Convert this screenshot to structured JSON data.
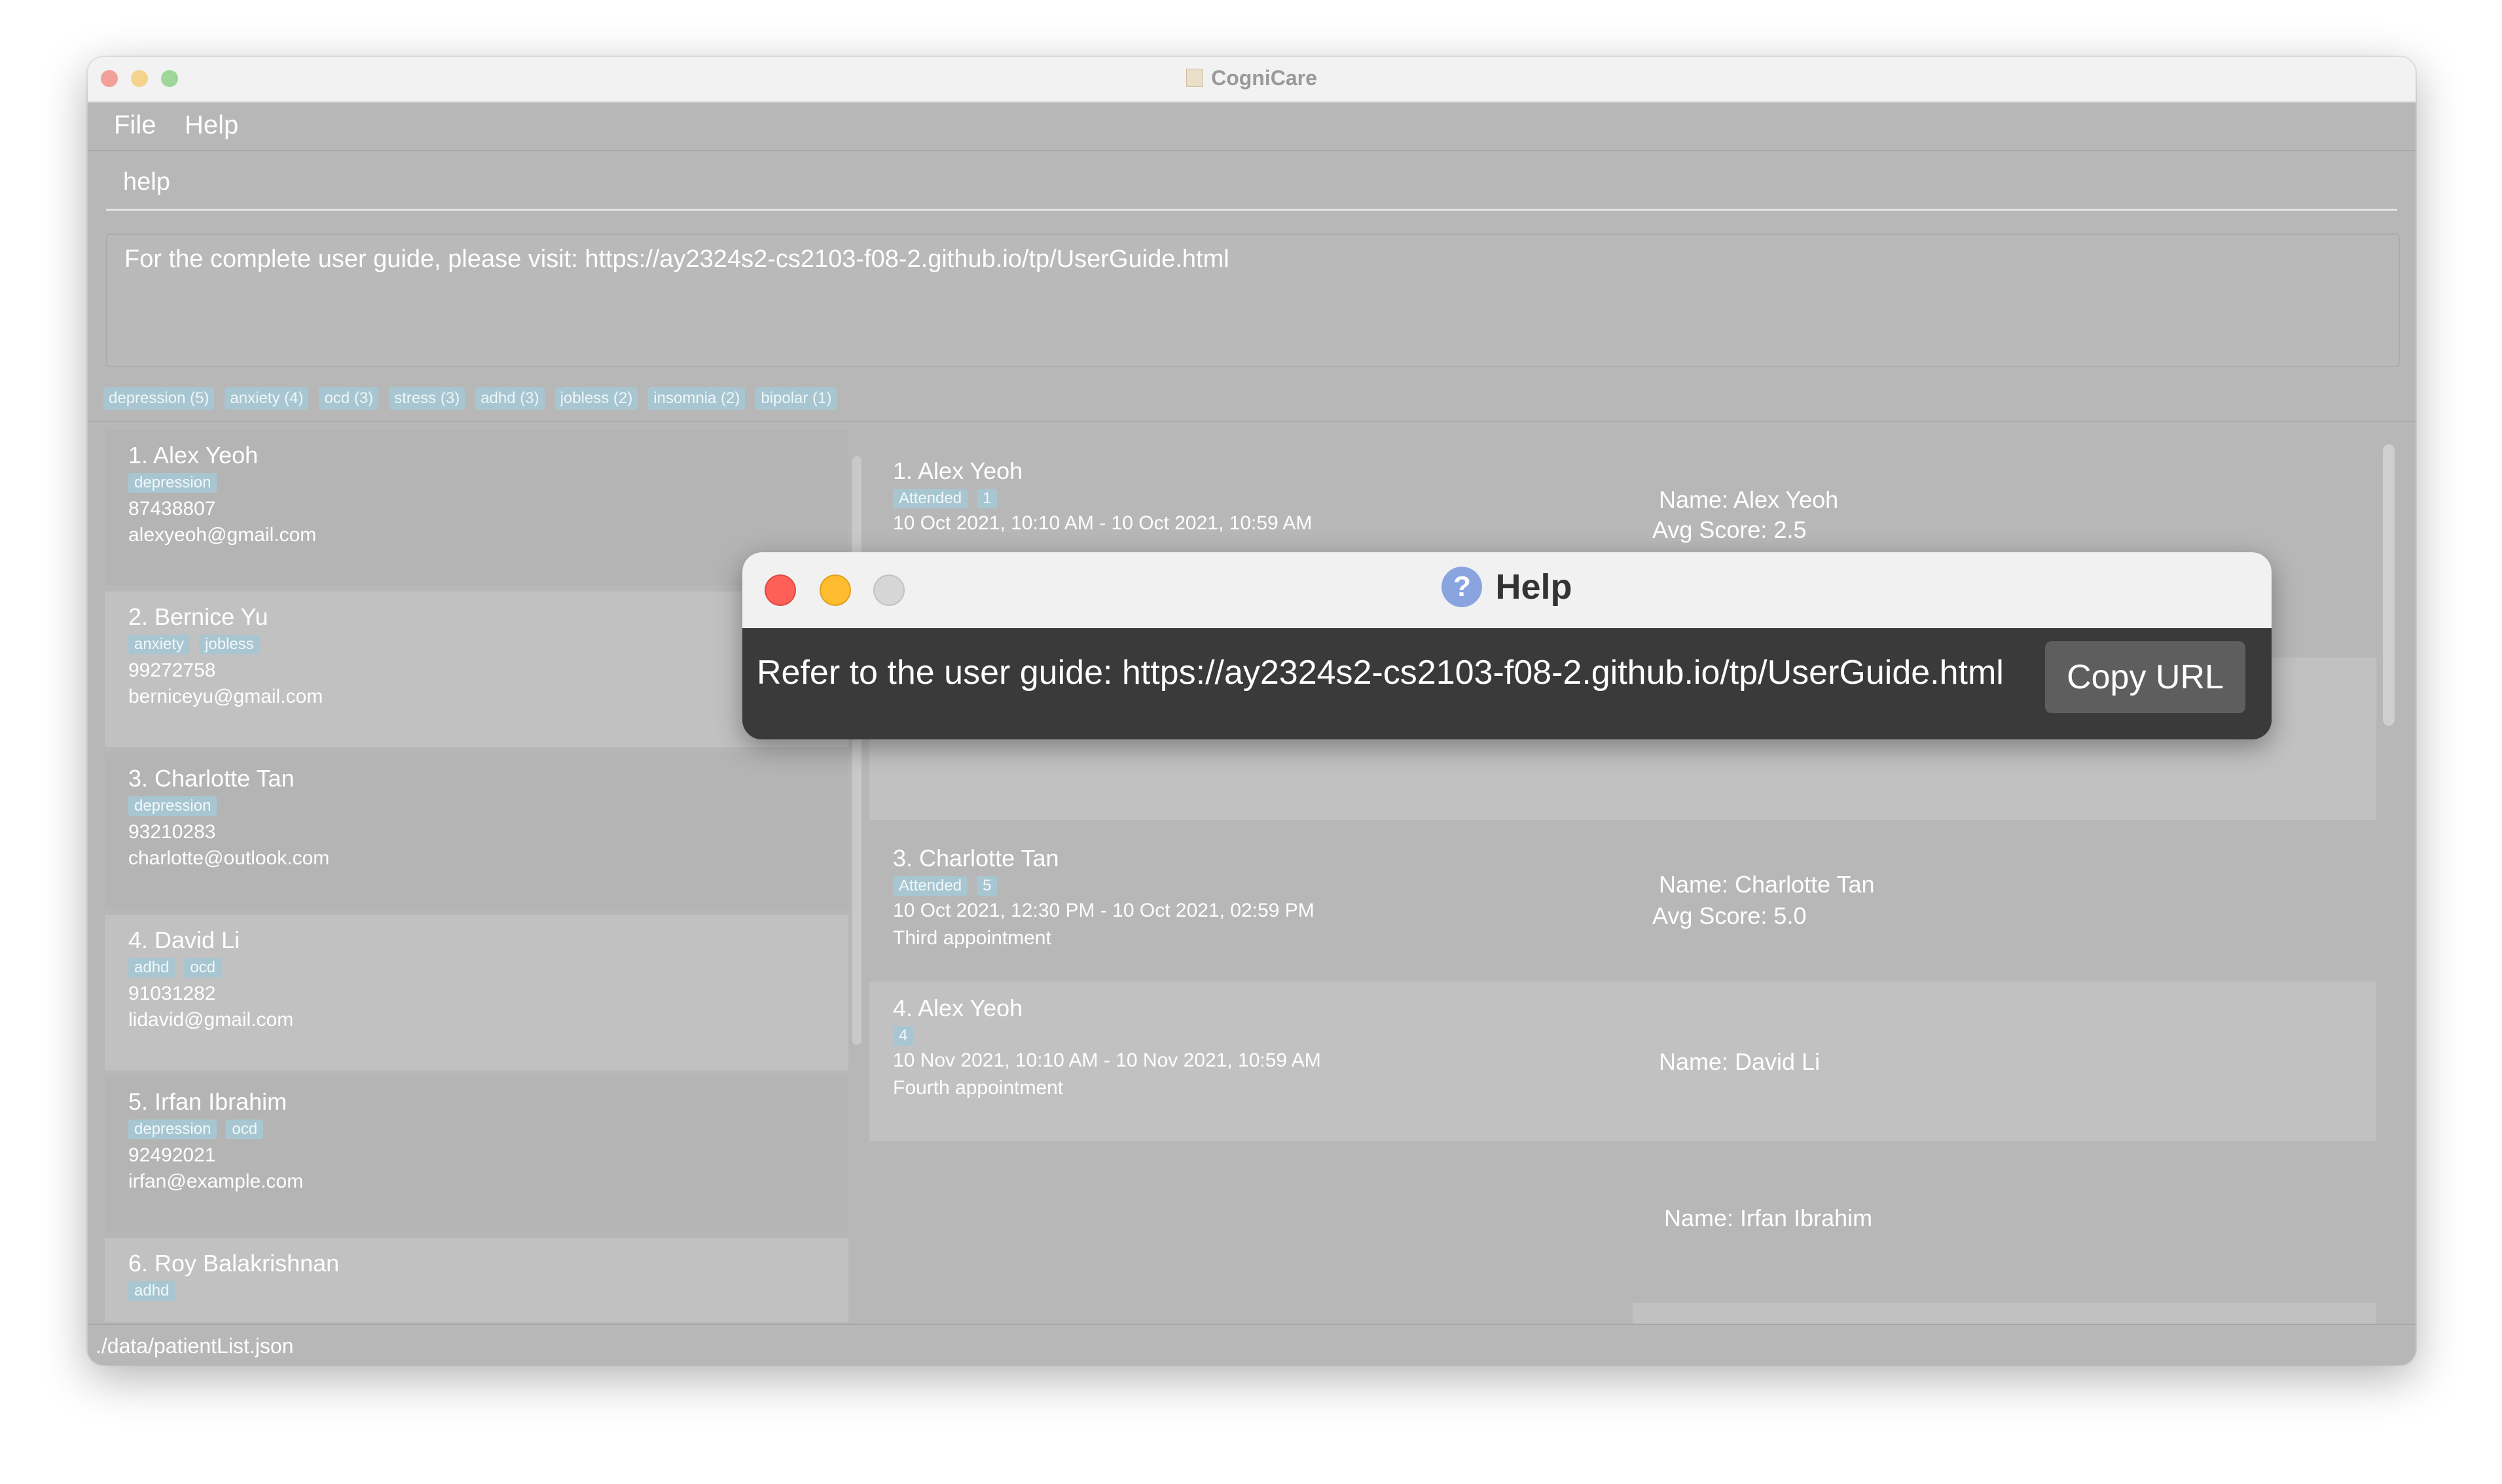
{
  "window": {
    "title": "CogniCare"
  },
  "menu": {
    "file": "File",
    "help": "Help"
  },
  "command": {
    "value": "help"
  },
  "result": {
    "text": "For the complete user guide, please visit: https://ay2324s2-cs2103-f08-2.github.io/tp/UserGuide.html"
  },
  "tags": [
    "depression (5)",
    "anxiety (4)",
    "ocd (3)",
    "stress (3)",
    "adhd (3)",
    "jobless (2)",
    "insomnia (2)",
    "bipolar (1)"
  ],
  "patients": [
    {
      "name": "1.  Alex Yeoh",
      "tags": [
        "depression"
      ],
      "phone": "87438807",
      "email": "alexyeoh@gmail.com"
    },
    {
      "name": "2.  Bernice Yu",
      "tags": [
        "anxiety",
        "jobless"
      ],
      "phone": "99272758",
      "email": "berniceyu@gmail.com"
    },
    {
      "name": "3.  Charlotte Tan",
      "tags": [
        "depression"
      ],
      "phone": "93210283",
      "email": "charlotte@outlook.com"
    },
    {
      "name": "4.  David Li",
      "tags": [
        "adhd",
        "ocd"
      ],
      "phone": "91031282",
      "email": "lidavid@gmail.com"
    },
    {
      "name": "5.  Irfan Ibrahim",
      "tags": [
        "depression",
        "ocd"
      ],
      "phone": "92492021",
      "email": "irfan@example.com"
    },
    {
      "name": "6.  Roy Balakrishnan",
      "tags": [
        "adhd"
      ]
    }
  ],
  "appointments": [
    {
      "title": "1.  Alex Yeoh",
      "tags": [
        "Attended",
        "1"
      ],
      "time": "10 Oct 2021, 10:10 AM - 10 Oct 2021, 10:59 AM",
      "description": "",
      "score_name": "Name: Alex Yeoh",
      "avg_score": "Avg Score: 2.5"
    },
    {
      "title": "3.  Charlotte Tan",
      "tags": [
        "Attended",
        "5"
      ],
      "time": "10 Oct 2021, 12:30 PM - 10 Oct 2021, 02:59 PM",
      "description": "Third appointment",
      "score_name": "Name: Charlotte Tan",
      "avg_score": "Avg Score: 5.0"
    },
    {
      "title": "4.  Alex Yeoh",
      "tags": [
        "4"
      ],
      "time": "10 Nov 2021, 10:10 AM - 10 Nov 2021, 10:59 AM",
      "description": "Fourth appointment",
      "score_name": "Name: David Li"
    }
  ],
  "score_extra": {
    "name": "Name: Irfan Ibrahim"
  },
  "status": {
    "path": "./data/patientList.json"
  },
  "dialog": {
    "title": "Help",
    "icon": "?",
    "message": "Refer to the user guide: https://ay2324s2-cs2103-f08-2.github.io/tp/UserGuide.html",
    "button": "Copy URL"
  }
}
